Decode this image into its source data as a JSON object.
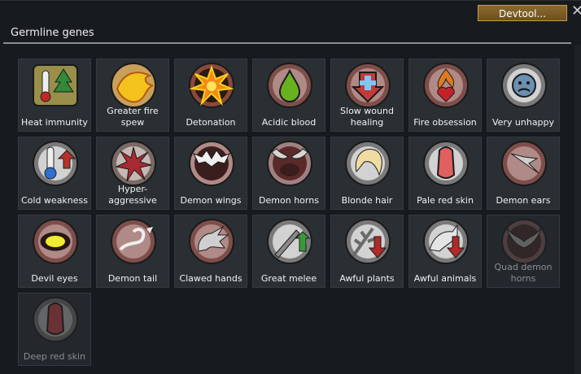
{
  "window": {
    "close_glyph": "✕"
  },
  "toolbar": {
    "devtool_label": "Devtool..."
  },
  "section": {
    "title": "Germline genes"
  },
  "genes": [
    {
      "label": "Heat immunity",
      "icon": "thermometer-tree-icon",
      "disabled": false
    },
    {
      "label": "Greater fire spew",
      "icon": "fire-spew-icon",
      "disabled": false
    },
    {
      "label": "Detonation",
      "icon": "explosion-icon",
      "disabled": false
    },
    {
      "label": "Acidic blood",
      "icon": "acid-drop-icon",
      "disabled": false
    },
    {
      "label": "Slow wound healing",
      "icon": "medical-cross-down-icon",
      "disabled": false
    },
    {
      "label": "Fire obsession",
      "icon": "flame-heart-icon",
      "disabled": false
    },
    {
      "label": "Very unhappy",
      "icon": "sad-face-icon",
      "disabled": false
    },
    {
      "label": "Cold weakness",
      "icon": "cold-thermometer-icon",
      "disabled": false
    },
    {
      "label": "Hyper-aggressive",
      "icon": "burst-icon",
      "disabled": false
    },
    {
      "label": "Demon wings",
      "icon": "demon-wings-icon",
      "disabled": false
    },
    {
      "label": "Demon horns",
      "icon": "demon-horns-icon",
      "disabled": false
    },
    {
      "label": "Blonde hair",
      "icon": "blonde-hair-icon",
      "disabled": false
    },
    {
      "label": "Pale red skin",
      "icon": "pale-red-skin-icon",
      "disabled": false
    },
    {
      "label": "Demon ears",
      "icon": "demon-ears-icon",
      "disabled": false
    },
    {
      "label": "Devil eyes",
      "icon": "devil-eye-icon",
      "disabled": false
    },
    {
      "label": "Demon tail",
      "icon": "demon-tail-icon",
      "disabled": false
    },
    {
      "label": "Clawed hands",
      "icon": "claw-icon",
      "disabled": false
    },
    {
      "label": "Great melee",
      "icon": "sword-up-icon",
      "disabled": false
    },
    {
      "label": "Awful plants",
      "icon": "plant-down-icon",
      "disabled": false
    },
    {
      "label": "Awful animals",
      "icon": "animal-down-icon",
      "disabled": false
    },
    {
      "label": "Quad demon horns",
      "icon": "quad-horns-icon",
      "disabled": true
    },
    {
      "label": "Deep red skin",
      "icon": "deep-red-skin-icon",
      "disabled": true
    }
  ]
}
